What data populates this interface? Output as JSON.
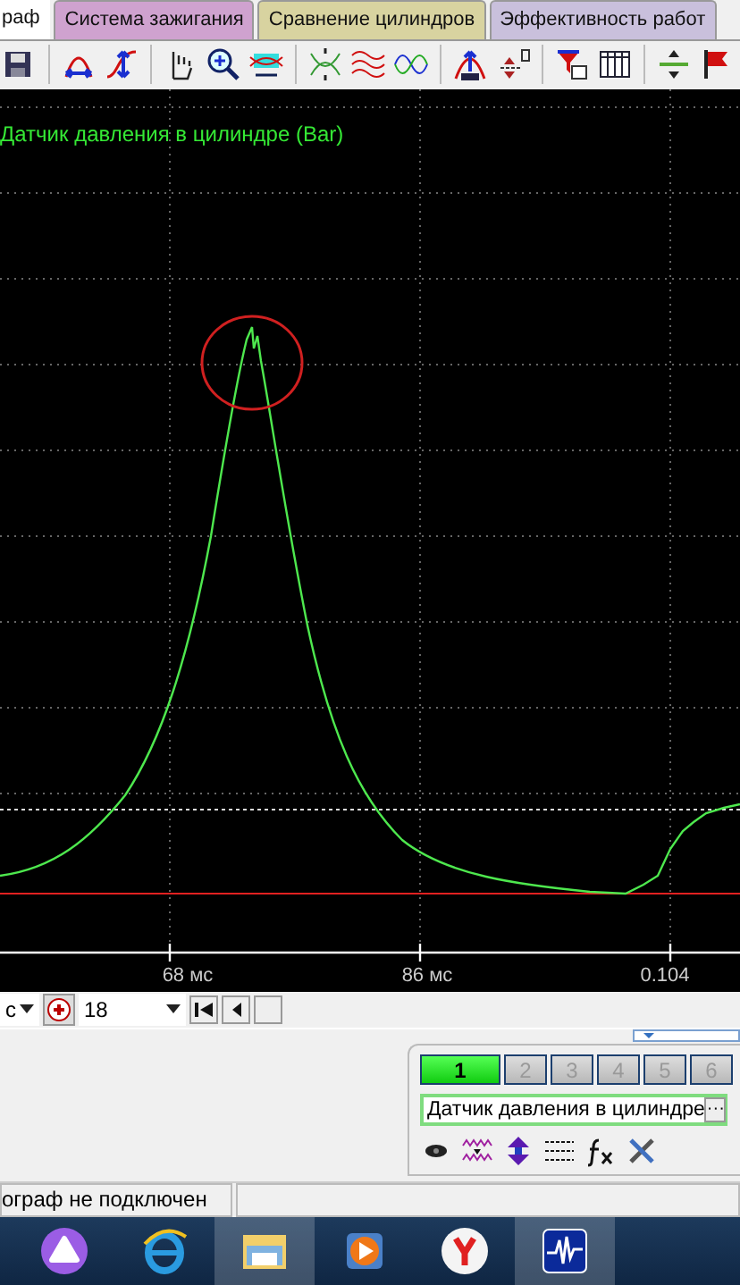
{
  "tabs": [
    {
      "label": "раф",
      "selected": true,
      "color": "#ffffff"
    },
    {
      "label": "Система зажигания",
      "selected": false,
      "color": "#cfa2cf"
    },
    {
      "label": "Сравнение цилиндров",
      "selected": false,
      "color": "#d8d3a0"
    },
    {
      "label": "Эффективность работ",
      "selected": false,
      "color": "#c9c0dc"
    }
  ],
  "chart": {
    "title": "Датчик давления в цилиндре (Bar)",
    "x_tick_labels": [
      "68 мс",
      "86 мс",
      "0.104"
    ]
  },
  "controls": {
    "unit_dropdown": "с",
    "channel_dropdown": "18"
  },
  "channel_buttons": [
    {
      "label": "1",
      "selected": true
    },
    {
      "label": "2",
      "selected": false
    },
    {
      "label": "3",
      "selected": false
    },
    {
      "label": "4",
      "selected": false
    },
    {
      "label": "5",
      "selected": false
    },
    {
      "label": "6",
      "selected": false
    }
  ],
  "sensor_field": {
    "value": "Датчик давления в цилиндре",
    "button": "···"
  },
  "status_bar": {
    "message": "ограф не подключен"
  }
}
